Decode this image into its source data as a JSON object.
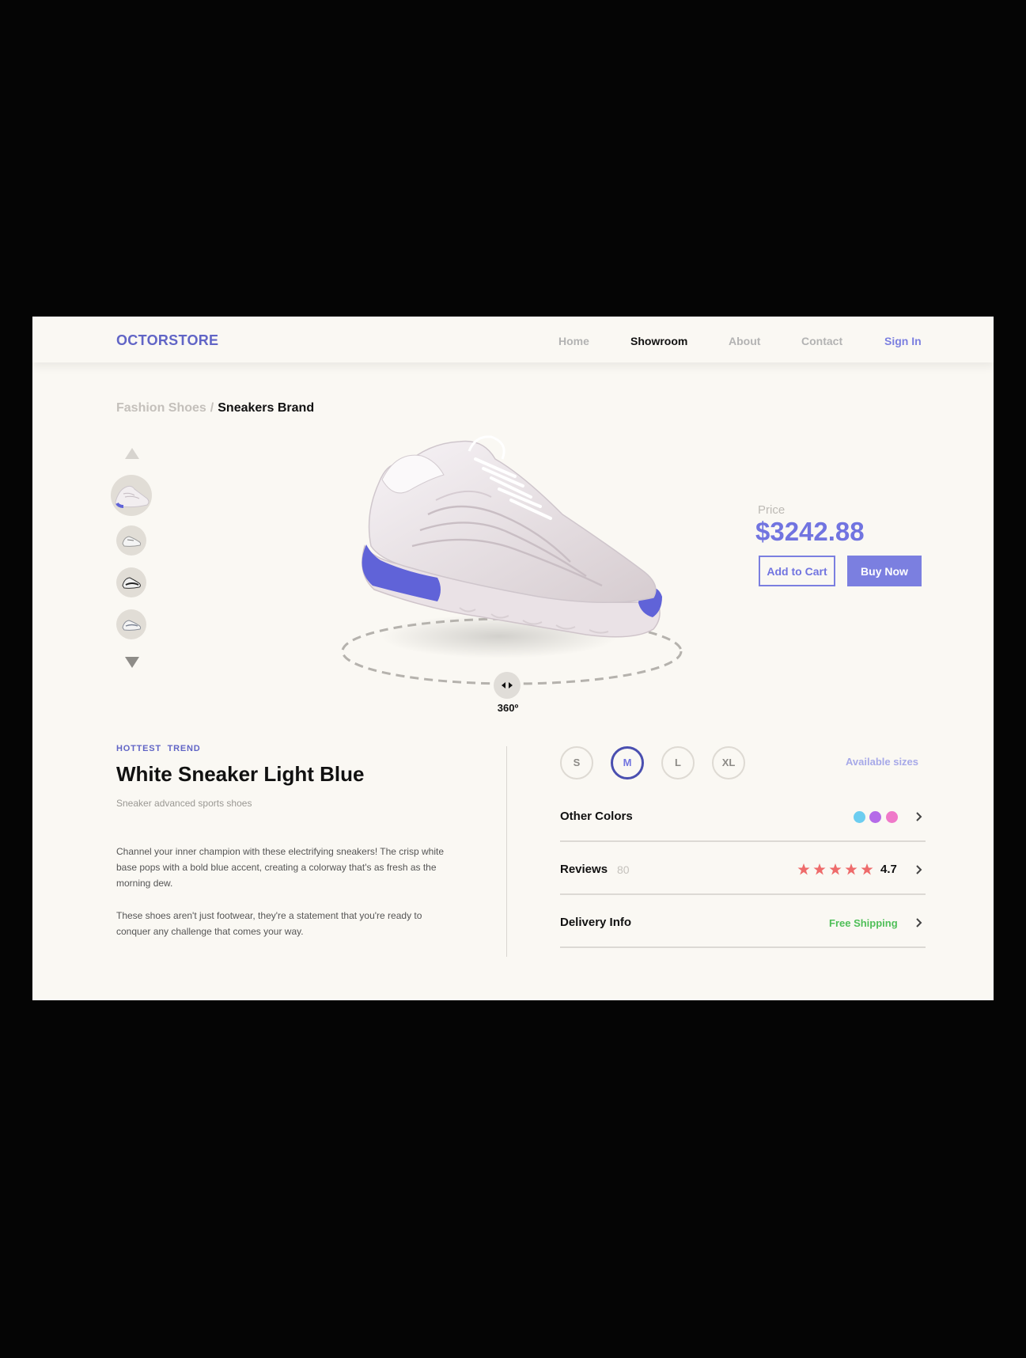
{
  "header": {
    "logo": "OCTORSTORE",
    "nav": [
      {
        "label": "Home",
        "active": false
      },
      {
        "label": "Showroom",
        "active": true
      },
      {
        "label": "About",
        "active": false
      },
      {
        "label": "Contact",
        "active": false
      }
    ],
    "signin": "Sign In"
  },
  "breadcrumb": {
    "parent": "Fashion Shoes",
    "separator": "/",
    "current": "Sneakers Brand"
  },
  "viewer": {
    "rotate_label": "360º",
    "thumbnails": [
      {
        "name": "thumbnail-1",
        "selected": true
      },
      {
        "name": "thumbnail-2",
        "selected": false
      },
      {
        "name": "thumbnail-3",
        "selected": false
      },
      {
        "name": "thumbnail-4",
        "selected": false
      }
    ]
  },
  "price": {
    "label": "Price",
    "value": "$3242.88",
    "add_to_cart": "Add to Cart",
    "buy_now": "Buy Now"
  },
  "product": {
    "tag": "HOTTEST  TREND",
    "title": "White Sneaker Light Blue",
    "subtitle": "Sneaker advanced sports shoes",
    "description": [
      "Channel your inner champion with these electrifying sneakers! The crisp white base pops with a bold blue accent, creating a colorway that's as fresh as the morning dew.",
      "These shoes aren't just footwear, they're a statement that you're ready to conquer any challenge that comes your way."
    ]
  },
  "sizes": {
    "options": [
      "S",
      "M",
      "L",
      "XL"
    ],
    "selected": "M",
    "label": "Available sizes"
  },
  "details": {
    "other_colors": {
      "label": "Other Colors",
      "colors": [
        "#6ccdf0",
        "#b56be8",
        "#ef79c9"
      ]
    },
    "reviews": {
      "label": "Reviews",
      "count": "80",
      "stars": 5,
      "rating": "4.7"
    },
    "delivery": {
      "label": "Delivery Info",
      "value": "Free Shipping"
    }
  },
  "colors": {
    "accent": "#7b7fe0",
    "brand": "#6165c6",
    "star": "#ee6b6b",
    "shipping": "#4fbf58",
    "background": "#faf8f3"
  }
}
